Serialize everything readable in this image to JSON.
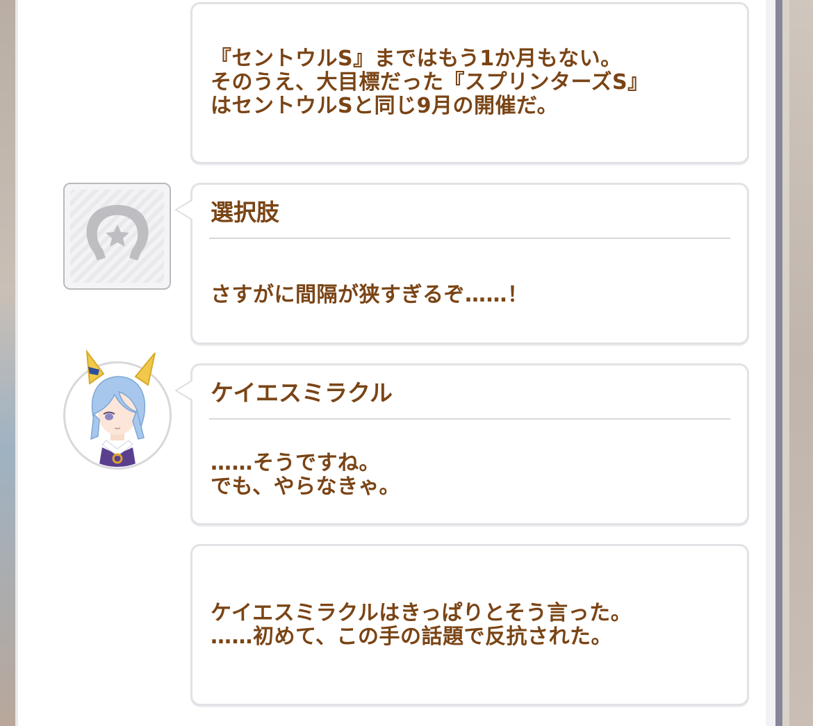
{
  "messages": [
    {
      "type": "narration",
      "text": "『セントウルS』まではもう1か月もない。\nそのうえ、大目標だった『スプリンターズS』\nはセントウルSと同じ9月の開催だ。"
    },
    {
      "type": "choice",
      "speaker": "選択肢",
      "avatar_icon": "horseshoe-star-icon",
      "text": "さすがに間隔が狭すぎるぞ……！"
    },
    {
      "type": "dialogue",
      "speaker": "ケイエスミラクル",
      "avatar_icon": "character-portrait-icon",
      "text": "……そうですね。\nでも、やらなきゃ。"
    },
    {
      "type": "narration",
      "text": "ケイエスミラクルはきっぱりとそう言った。\n……初めて、この手の話題で反抗された。"
    }
  ],
  "colors": {
    "text": "#7a4415",
    "bubble_border": "#e2e2e6",
    "panel_edge": "#86869a",
    "character_hair": "#a7c8ec",
    "ear": "#f1c94a",
    "ribbon": "#2c4f9a"
  }
}
